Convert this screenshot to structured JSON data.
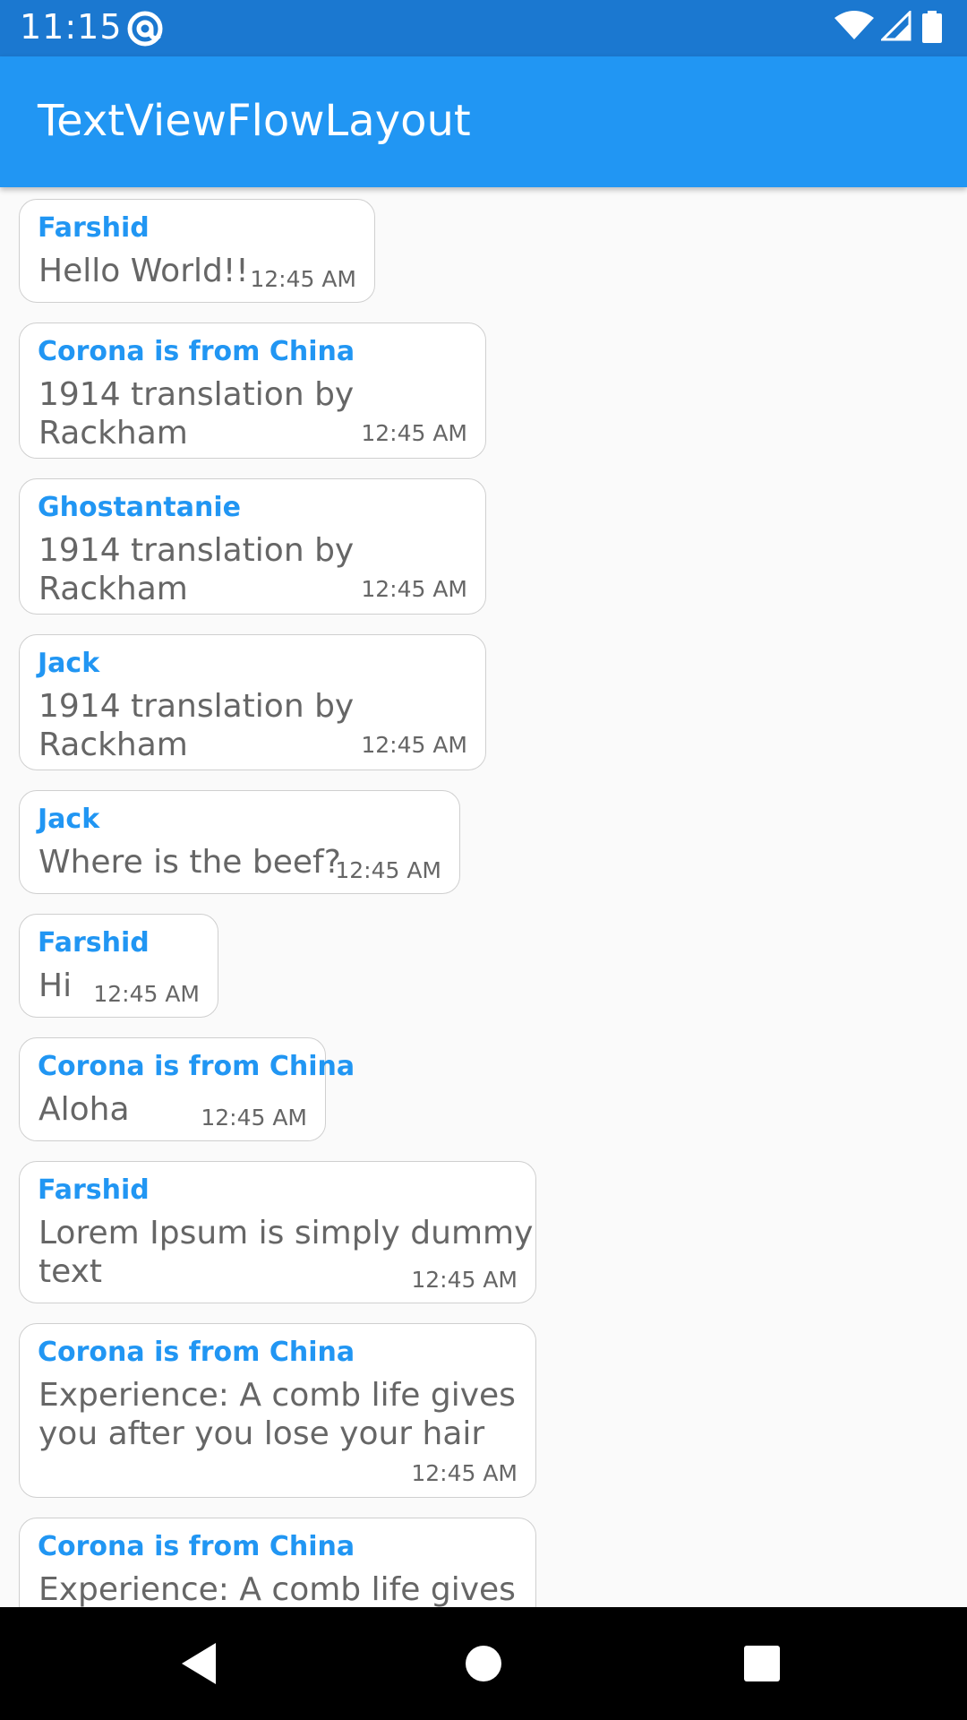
{
  "status_bar": {
    "time": "11:15",
    "icons": [
      "at-sign-icon",
      "wifi-icon",
      "signal-icon",
      "battery-icon"
    ]
  },
  "app_bar": {
    "title": "TextViewFlowLayout"
  },
  "colors": {
    "status_bar": "#1b78d0",
    "app_bar": "#2196f3",
    "sender_name": "#2196f3",
    "message_text": "#666666",
    "background": "#fafafa",
    "bubble_border": "#cfcfcf"
  },
  "messages": [
    {
      "sender": "Farshid",
      "text": "Hello World!!",
      "time": "12:45 AM"
    },
    {
      "sender": "Corona is from China",
      "text": "1914 translation by Rackham",
      "time": "12:45 AM"
    },
    {
      "sender": "Ghostantanie",
      "text": "1914 translation by Rackham",
      "time": "12:45 AM"
    },
    {
      "sender": "Jack",
      "text": "1914 translation by Rackham",
      "time": "12:45 AM"
    },
    {
      "sender": "Jack",
      "text": "Where is the beef?",
      "time": "12:45 AM"
    },
    {
      "sender": "Farshid",
      "text": "Hi",
      "time": "12:45 AM"
    },
    {
      "sender": "Corona is from China",
      "text": "Aloha",
      "time": "12:45 AM"
    },
    {
      "sender": "Farshid",
      "text": "Lorem Ipsum is simply dummy\ntext",
      "time": "12:45 AM"
    },
    {
      "sender": "Corona is from China",
      "text": "Experience: A comb life gives\nyou after you lose your hair",
      "time": "12:45 AM"
    },
    {
      "sender": "Corona is from China",
      "text": "Experience: A comb life gives",
      "time": ""
    }
  ],
  "nav_bar": {
    "buttons": [
      "back-icon",
      "home-icon",
      "recents-icon"
    ]
  }
}
